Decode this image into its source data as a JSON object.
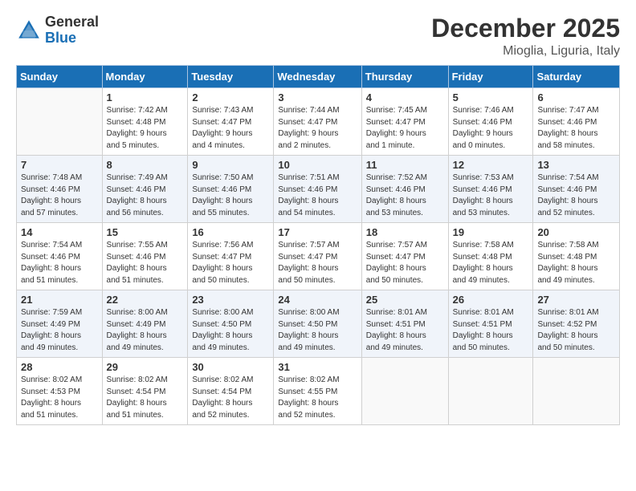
{
  "logo": {
    "general": "General",
    "blue": "Blue"
  },
  "header": {
    "month": "December 2025",
    "location": "Mioglia, Liguria, Italy"
  },
  "weekdays": [
    "Sunday",
    "Monday",
    "Tuesday",
    "Wednesday",
    "Thursday",
    "Friday",
    "Saturday"
  ],
  "weeks": [
    [
      {
        "day": "",
        "info": ""
      },
      {
        "day": "1",
        "info": "Sunrise: 7:42 AM\nSunset: 4:48 PM\nDaylight: 9 hours\nand 5 minutes."
      },
      {
        "day": "2",
        "info": "Sunrise: 7:43 AM\nSunset: 4:47 PM\nDaylight: 9 hours\nand 4 minutes."
      },
      {
        "day": "3",
        "info": "Sunrise: 7:44 AM\nSunset: 4:47 PM\nDaylight: 9 hours\nand 2 minutes."
      },
      {
        "day": "4",
        "info": "Sunrise: 7:45 AM\nSunset: 4:47 PM\nDaylight: 9 hours\nand 1 minute."
      },
      {
        "day": "5",
        "info": "Sunrise: 7:46 AM\nSunset: 4:46 PM\nDaylight: 9 hours\nand 0 minutes."
      },
      {
        "day": "6",
        "info": "Sunrise: 7:47 AM\nSunset: 4:46 PM\nDaylight: 8 hours\nand 58 minutes."
      }
    ],
    [
      {
        "day": "7",
        "info": "Sunrise: 7:48 AM\nSunset: 4:46 PM\nDaylight: 8 hours\nand 57 minutes."
      },
      {
        "day": "8",
        "info": "Sunrise: 7:49 AM\nSunset: 4:46 PM\nDaylight: 8 hours\nand 56 minutes."
      },
      {
        "day": "9",
        "info": "Sunrise: 7:50 AM\nSunset: 4:46 PM\nDaylight: 8 hours\nand 55 minutes."
      },
      {
        "day": "10",
        "info": "Sunrise: 7:51 AM\nSunset: 4:46 PM\nDaylight: 8 hours\nand 54 minutes."
      },
      {
        "day": "11",
        "info": "Sunrise: 7:52 AM\nSunset: 4:46 PM\nDaylight: 8 hours\nand 53 minutes."
      },
      {
        "day": "12",
        "info": "Sunrise: 7:53 AM\nSunset: 4:46 PM\nDaylight: 8 hours\nand 53 minutes."
      },
      {
        "day": "13",
        "info": "Sunrise: 7:54 AM\nSunset: 4:46 PM\nDaylight: 8 hours\nand 52 minutes."
      }
    ],
    [
      {
        "day": "14",
        "info": "Sunrise: 7:54 AM\nSunset: 4:46 PM\nDaylight: 8 hours\nand 51 minutes."
      },
      {
        "day": "15",
        "info": "Sunrise: 7:55 AM\nSunset: 4:46 PM\nDaylight: 8 hours\nand 51 minutes."
      },
      {
        "day": "16",
        "info": "Sunrise: 7:56 AM\nSunset: 4:47 PM\nDaylight: 8 hours\nand 50 minutes."
      },
      {
        "day": "17",
        "info": "Sunrise: 7:57 AM\nSunset: 4:47 PM\nDaylight: 8 hours\nand 50 minutes."
      },
      {
        "day": "18",
        "info": "Sunrise: 7:57 AM\nSunset: 4:47 PM\nDaylight: 8 hours\nand 50 minutes."
      },
      {
        "day": "19",
        "info": "Sunrise: 7:58 AM\nSunset: 4:48 PM\nDaylight: 8 hours\nand 49 minutes."
      },
      {
        "day": "20",
        "info": "Sunrise: 7:58 AM\nSunset: 4:48 PM\nDaylight: 8 hours\nand 49 minutes."
      }
    ],
    [
      {
        "day": "21",
        "info": "Sunrise: 7:59 AM\nSunset: 4:49 PM\nDaylight: 8 hours\nand 49 minutes."
      },
      {
        "day": "22",
        "info": "Sunrise: 8:00 AM\nSunset: 4:49 PM\nDaylight: 8 hours\nand 49 minutes."
      },
      {
        "day": "23",
        "info": "Sunrise: 8:00 AM\nSunset: 4:50 PM\nDaylight: 8 hours\nand 49 minutes."
      },
      {
        "day": "24",
        "info": "Sunrise: 8:00 AM\nSunset: 4:50 PM\nDaylight: 8 hours\nand 49 minutes."
      },
      {
        "day": "25",
        "info": "Sunrise: 8:01 AM\nSunset: 4:51 PM\nDaylight: 8 hours\nand 49 minutes."
      },
      {
        "day": "26",
        "info": "Sunrise: 8:01 AM\nSunset: 4:51 PM\nDaylight: 8 hours\nand 50 minutes."
      },
      {
        "day": "27",
        "info": "Sunrise: 8:01 AM\nSunset: 4:52 PM\nDaylight: 8 hours\nand 50 minutes."
      }
    ],
    [
      {
        "day": "28",
        "info": "Sunrise: 8:02 AM\nSunset: 4:53 PM\nDaylight: 8 hours\nand 51 minutes."
      },
      {
        "day": "29",
        "info": "Sunrise: 8:02 AM\nSunset: 4:54 PM\nDaylight: 8 hours\nand 51 minutes."
      },
      {
        "day": "30",
        "info": "Sunrise: 8:02 AM\nSunset: 4:54 PM\nDaylight: 8 hours\nand 52 minutes."
      },
      {
        "day": "31",
        "info": "Sunrise: 8:02 AM\nSunset: 4:55 PM\nDaylight: 8 hours\nand 52 minutes."
      },
      {
        "day": "",
        "info": ""
      },
      {
        "day": "",
        "info": ""
      },
      {
        "day": "",
        "info": ""
      }
    ]
  ]
}
